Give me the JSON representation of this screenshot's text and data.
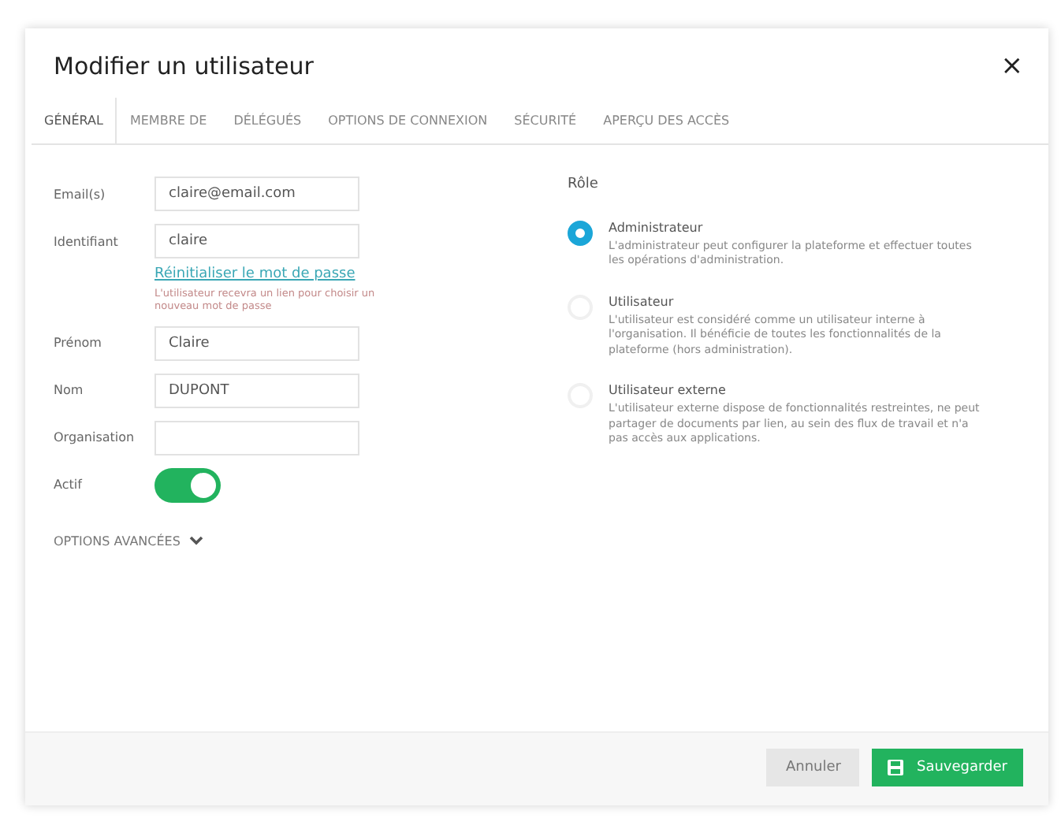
{
  "dialog": {
    "title": "Modifier un utilisateur",
    "close": "×"
  },
  "tabs": [
    {
      "label": "GÉNÉRAL",
      "selected": true
    },
    {
      "label": "MEMBRE DE",
      "selected": false
    },
    {
      "label": "DÉLÉGUÉS",
      "selected": false
    },
    {
      "label": "OPTIONS DE CONNEXION",
      "selected": false
    },
    {
      "label": "SÉCURITÉ",
      "selected": false
    },
    {
      "label": "APERÇU DES ACCÈS",
      "selected": false
    }
  ],
  "fields": [
    {
      "label": "Email(s)",
      "value": "claire@email.com"
    },
    {
      "label": "Identifiant",
      "value": "claire",
      "link": "Réinitialiser le mot de passe",
      "hint": "L'utilisateur recevra un lien pour choisir un nouveau mot de passe"
    },
    {
      "label": "Prénom",
      "value": "Claire"
    },
    {
      "label": "Nom",
      "value": "DUPONT"
    },
    {
      "label": "Organisation"
    }
  ],
  "active": {
    "label": "Actif",
    "on": true
  },
  "advanced": {
    "label": "OPTIONS AVANCÉES",
    "expanded": false
  },
  "role": {
    "label": "Rôle",
    "options": [
      {
        "title": "Administrateur",
        "description": "L'administrateur peut configurer la plateforme et effectuer toutes les opérations d'administration.",
        "selected": true
      },
      {
        "title": "Utilisateur",
        "description": "L'utilisateur est considéré comme un utilisateur interne à l'organisation. Il bénéficie de toutes les fonctionnalités de la plateforme (hors administration).",
        "selected": false
      },
      {
        "title": "Utilisateur externe",
        "description": "L'utilisateur externe dispose de fonctionnalités restreintes, ne peut partager de documents par lien, au sein des flux de travail et n'a pas accès aux applications.",
        "selected": false
      }
    ]
  },
  "buttons": {
    "cancel": "Annuler",
    "save": "Sauvegarder"
  }
}
